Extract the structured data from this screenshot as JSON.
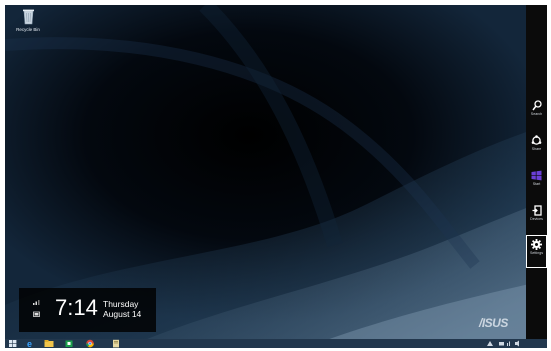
{
  "desktop": {
    "icons": [
      {
        "label": "Recycle Bin",
        "icon": "recycle-bin-icon"
      }
    ]
  },
  "clock": {
    "time": "7:14",
    "day": "Thursday",
    "date": "August 14"
  },
  "charms": [
    {
      "label": "Search",
      "icon": "search-icon"
    },
    {
      "label": "Share",
      "icon": "share-icon"
    },
    {
      "label": "Start",
      "icon": "windows-logo-icon",
      "color": "#6a3fd6"
    },
    {
      "label": "Devices",
      "icon": "devices-icon"
    },
    {
      "label": "Settings",
      "icon": "gear-icon",
      "selected": true
    }
  ],
  "brand": {
    "logo": "/ISUS"
  },
  "taskbar": {
    "apps": [
      "start-button-icon",
      "internet-explorer-icon",
      "file-explorer-icon",
      "store-icon",
      "chrome-icon",
      "document-app-icon"
    ]
  },
  "colors": {
    "taskbar": "#22374d",
    "charms_bar": "#0b0b0b",
    "desktop": "#02070d",
    "start_tile": "#6a3fd6"
  }
}
